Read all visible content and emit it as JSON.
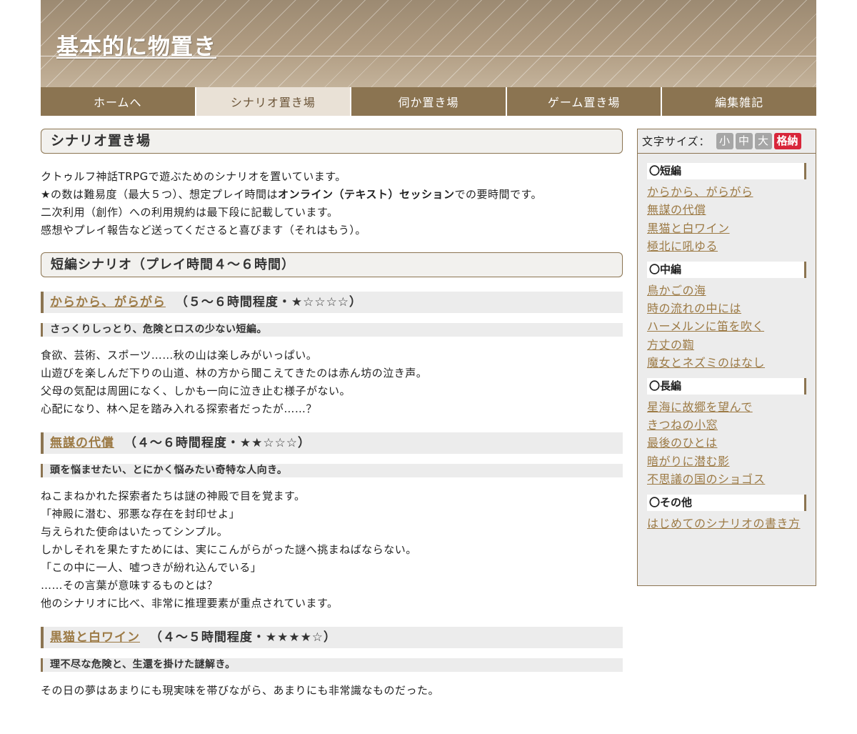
{
  "header": {
    "site_title": "基本的に物置き"
  },
  "nav": {
    "items": [
      {
        "label": "ホームへ"
      },
      {
        "label": "シナリオ置き場"
      },
      {
        "label": "伺か置き場"
      },
      {
        "label": "ゲーム置き場"
      },
      {
        "label": "編集雑記"
      }
    ],
    "active_index": 1
  },
  "main": {
    "page_title": "シナリオ置き場",
    "intro": {
      "line1": "クトゥルフ神話TRPGで遊ぶためのシナリオを置いています。",
      "line2a": "★の数は難易度（最大５つ）、想定プレイ時間は",
      "line2b": "オンライン（テキスト）セッション",
      "line2c": "での要時間です。",
      "line3": "二次利用（創作）への利用規約は最下段に記載しています。",
      "line4": "感想やプレイ報告など送ってくださると喜びます（それはもう）。"
    },
    "short_heading": "短編シナリオ（プレイ時間４～６時間）",
    "scenarios": [
      {
        "title": "からから、がらがら",
        "meta": "（５～６時間程度・★☆☆☆☆）",
        "tagline": "さっくりしっとり、危険とロスの少ない短編。",
        "description": [
          "食欲、芸術、スポーツ……秋の山は楽しみがいっぱい。",
          "山遊びを楽しんだ下りの山道、林の方から聞こえてきたのは赤ん坊の泣き声。",
          "父母の気配は周囲になく、しかも一向に泣き止む様子がない。",
          "心配になり、林へ足を踏み入れる探索者だったが……？"
        ]
      },
      {
        "title": "無謀の代償",
        "meta": "（４～６時間程度・★★☆☆☆）",
        "tagline": "頭を悩ませたい、とにかく悩みたい奇特な人向き。",
        "description": [
          "ねこまねかれた探索者たちは謎の神殿で目を覚ます。",
          "「神殿に潜む、邪悪な存在を封印せよ」",
          "与えられた使命はいたってシンプル。",
          "しかしそれを果たすためには、実にこんがらがった謎へ挑まねばならない。",
          "「この中に一人、嘘つきが紛れ込んでいる」",
          "……その言葉が意味するものとは？",
          "他のシナリオに比べ、非常に推理要素が重点されています。"
        ]
      },
      {
        "title": "黒猫と白ワイン",
        "meta": "（４～５時間程度・★★★★☆）",
        "tagline": "理不尽な危険と、生還を掛けた謎解き。",
        "description": [
          "その日の夢はあまりにも現実味を帯びながら、あまりにも非常識なものだった。"
        ]
      }
    ]
  },
  "sidebar": {
    "font_size_label": "文字サイズ：",
    "font_buttons": {
      "small": "小",
      "medium": "中",
      "large": "大",
      "store": "格納"
    },
    "groups": [
      {
        "heading": "〇短編",
        "links": [
          "からから、がらがら",
          "無謀の代償",
          "黒猫と白ワイン",
          "極北に吼ゆる"
        ]
      },
      {
        "heading": "〇中編",
        "links": [
          "鳥かごの海",
          "時の流れの中には",
          "ハーメルンに笛を吹く",
          "方丈の鞫",
          "魔女とネズミのはなし"
        ]
      },
      {
        "heading": "〇長編",
        "links": [
          "星海に故郷を望んで",
          "きつねの小窓",
          "最後のひとは",
          "暗がりに潜む影",
          "不思議の国のショゴス"
        ]
      },
      {
        "heading": "〇その他",
        "links": [
          "はじめてのシナリオの書き方"
        ]
      }
    ]
  },
  "colors": {
    "accent": "#8b7451",
    "link": "#9c7a45",
    "store_button": "#d8253a"
  }
}
